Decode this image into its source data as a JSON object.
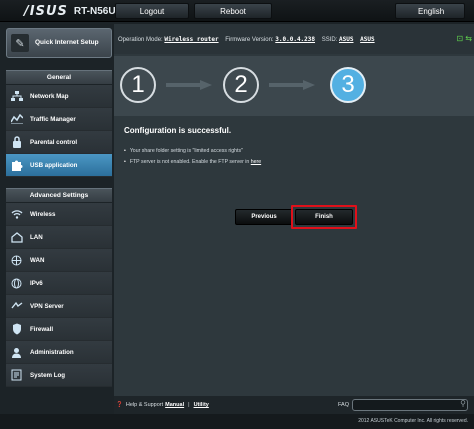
{
  "header": {
    "brand": "/ISUS",
    "model": "RT-N56U",
    "logout_label": "Logout",
    "reboot_label": "Reboot",
    "language": "English"
  },
  "sidebar": {
    "qis_label": "Quick Internet Setup",
    "general_title": "General",
    "general_items": [
      {
        "label": "Network Map",
        "icon": "network-map-icon"
      },
      {
        "label": "Traffic Manager",
        "icon": "traffic-manager-icon"
      },
      {
        "label": "Parental control",
        "icon": "parental-control-icon"
      },
      {
        "label": "USB application",
        "icon": "usb-puzzle-icon",
        "active": true
      }
    ],
    "advanced_title": "Advanced Settings",
    "advanced_items": [
      {
        "label": "Wireless",
        "icon": "wireless-icon"
      },
      {
        "label": "LAN",
        "icon": "lan-icon"
      },
      {
        "label": "WAN",
        "icon": "wan-globe-icon"
      },
      {
        "label": "IPv6",
        "icon": "ipv6-globe-icon"
      },
      {
        "label": "VPN Server",
        "icon": "vpn-icon"
      },
      {
        "label": "Firewall",
        "icon": "firewall-icon"
      },
      {
        "label": "Administration",
        "icon": "administration-icon"
      },
      {
        "label": "System Log",
        "icon": "system-log-icon"
      }
    ]
  },
  "info": {
    "mode_label": "Operation Mode:",
    "mode_value": "Wireless router",
    "firmware_label": "Firmware Version:",
    "firmware_value": "3.0.0.4.238",
    "ssid_label": "SSID:",
    "ssid_value_1": "ASUS",
    "ssid_value_2": "ASUS"
  },
  "steps": [
    "1",
    "2",
    "3"
  ],
  "content": {
    "title": "Configuration is successful.",
    "bullet1": "Your share folder setting is \"limited access rights\"",
    "bullet2": "FTP server is not enabled. Enable the FTP server in",
    "bullet2_link": "here",
    "previous_label": "Previous",
    "finish_label": "Finish"
  },
  "footer": {
    "help_label": "Help & Support",
    "manual_label": "Manual",
    "sep": "|",
    "utility_label": "Utility",
    "faq_label": "FAQ",
    "copyright": "2012 ASUSTeK Computer Inc. All rights reserved."
  }
}
